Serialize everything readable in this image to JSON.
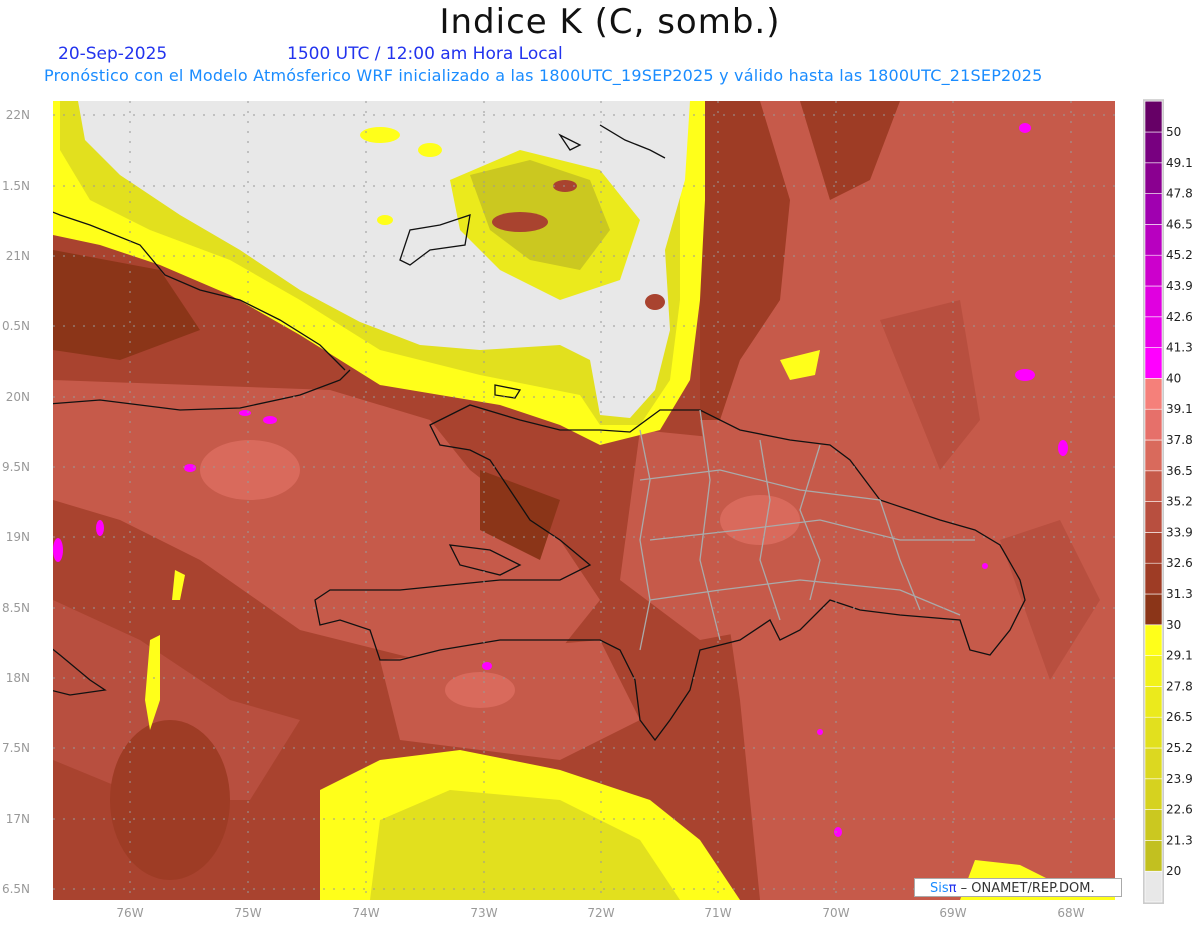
{
  "header": {
    "title": "Indice K (C, somb.)",
    "date": "20-Sep-2025",
    "time": "1500 UTC / 12:00 am Hora Local",
    "subtitle": "Pronóstico con el Modelo Atmósferico WRF inicializado a las 1800UTC_19SEP2025 y válido hasta las  1800UTC_21SEP2025"
  },
  "axes": {
    "lat_labels": [
      "22N",
      "1.5N",
      "21N",
      "0.5N",
      "20N",
      "9.5N",
      "19N",
      "8.5N",
      "18N",
      "7.5N",
      "17N",
      "6.5N"
    ],
    "lon_labels": [
      "76W",
      "75W",
      "74W",
      "73W",
      "72W",
      "71W",
      "70W",
      "69W",
      "68W"
    ]
  },
  "colorbar": {
    "levels": [
      "20",
      "21.3",
      "22.6",
      "23.9",
      "25.2",
      "26.5",
      "27.8",
      "29.1",
      "30",
      "31.3",
      "32.6",
      "33.9",
      "35.2",
      "36.5",
      "37.8",
      "39.1",
      "40",
      "41.3",
      "42.6",
      "43.9",
      "45.2",
      "46.5",
      "47.8",
      "49.1",
      "50"
    ],
    "colors": [
      "#e8e8e8",
      "#c2c020",
      "#cbc820",
      "#d6d21f",
      "#dcd820",
      "#e2e01e",
      "#ebea1c",
      "#f2f21a",
      "#ffff1a",
      "#8b3518",
      "#9e3c25",
      "#a9432f",
      "#b84f3f",
      "#c65a4a",
      "#d96a5c",
      "#e6706a",
      "#f5807a",
      "#ff00ff",
      "#ea00ea",
      "#e000e0",
      "#cc00cc",
      "#b800c0",
      "#a000b0",
      "#8a0090",
      "#780080",
      "#660066"
    ]
  },
  "footer": {
    "brand": "Sis",
    "brand_symbol": "π",
    "credit": " –  ONAMET/REP.DOM."
  }
}
